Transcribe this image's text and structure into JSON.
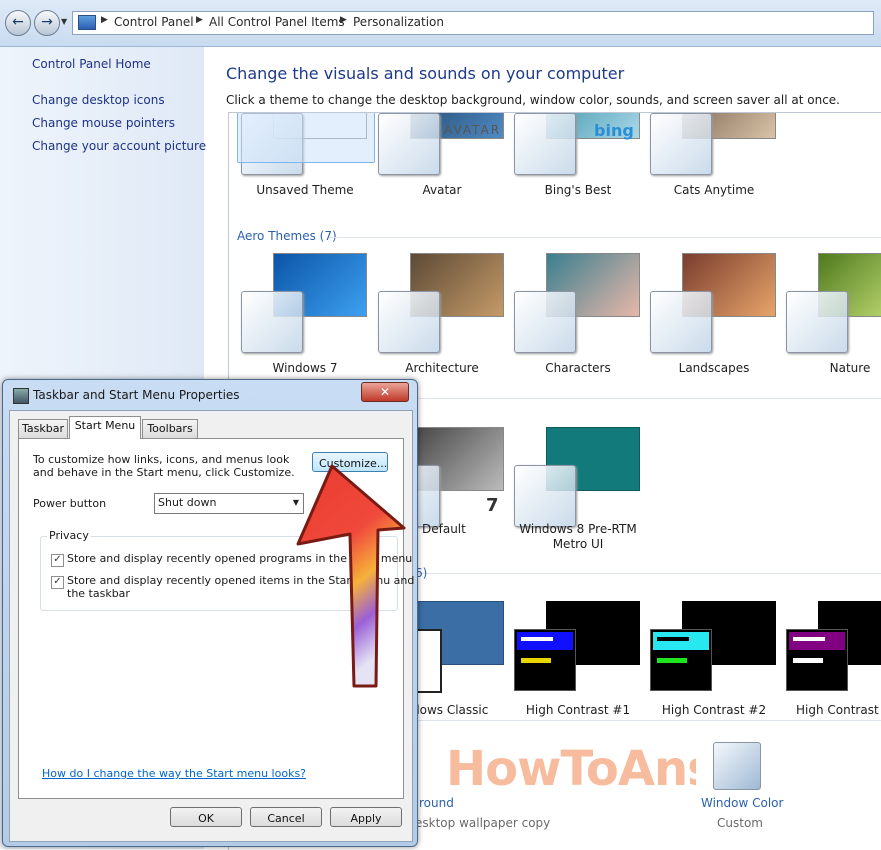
{
  "address_bar": {
    "crumbs": [
      "Control Panel",
      "All Control Panel Items",
      "Personalization"
    ]
  },
  "left_pane": {
    "links": [
      "Control Panel Home",
      "Change desktop icons",
      "Change mouse pointers",
      "Change your account picture"
    ]
  },
  "main": {
    "title": "Change the visuals and sounds on your computer",
    "subtitle": "Click a theme to change the desktop background, window color, sounds, and screen saver all at once."
  },
  "themes": {
    "my_themes": [
      "Unsaved Theme",
      "Avatar",
      "Bing's Best",
      "Cats Anytime"
    ],
    "aero_group_label": "Aero Themes (7)",
    "aero_themes": [
      "Windows 7",
      "Architecture",
      "Characters",
      "Landscapes",
      "Nature"
    ],
    "installed_themes": [
      "Default",
      "Windows 8 Pre-RTM",
      "Metro UI"
    ],
    "hc_group_fragment": "6)",
    "basic_themes": [
      "dows Classic",
      "High Contrast #1",
      "High Contrast #2",
      "High Contrast B"
    ],
    "bottom_links": [
      "round",
      "esktop wallpaper copy",
      "Window Color",
      "Custom"
    ],
    "logo_text_avatar": "AVATAR",
    "logo_text_bing": "bing"
  },
  "dialog": {
    "title": "Taskbar and Start Menu Properties",
    "tabs": [
      "Taskbar",
      "Start Menu",
      "Toolbars"
    ],
    "description_line1": "To customize how links, icons, and menus look",
    "description_line2": "and behave in the Start menu, click Customize.",
    "customize_label": "Customize...",
    "power_label": "Power button",
    "power_value": "Shut down",
    "privacy_label": "Privacy",
    "privacy_opt1": "Store and display recently opened programs in the Start menu",
    "privacy_opt2_line1": "Store and display recently opened items in the Start menu and",
    "privacy_opt2_line2": "the taskbar",
    "help_link": "How do I change the way the Start menu looks?",
    "ok_label": "OK",
    "cancel_label": "Cancel",
    "apply_label": "Apply"
  },
  "watermark": "HowToAns.com",
  "colors": {
    "link": "#1e3287",
    "title": "#1e3a8a",
    "arrow": "#e0342f"
  }
}
